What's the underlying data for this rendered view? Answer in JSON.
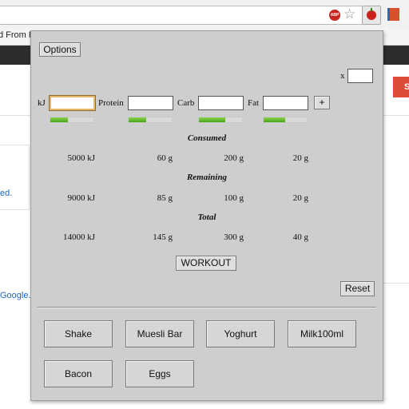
{
  "browser": {
    "bookmark_text": "d From Fi",
    "abp_label": "ABP",
    "red_button_label": "S",
    "link1": "ed.",
    "link2": "Google.c"
  },
  "popup": {
    "options_label": "Options",
    "x_label": "x",
    "labels": {
      "kj": "kJ",
      "protein": "Protein",
      "carb": "Carb",
      "fat": "Fat"
    },
    "plus_label": "+",
    "progress": {
      "kj": 0.4,
      "protein": 0.4,
      "carb": 0.62,
      "fat": 0.5
    },
    "sections": {
      "consumed": {
        "title": "Consumed",
        "values": [
          "5000 kJ",
          "60 g",
          "200 g",
          "20 g"
        ]
      },
      "remaining": {
        "title": "Remaining",
        "values": [
          "9000 kJ",
          "85 g",
          "100 g",
          "20 g"
        ]
      },
      "total": {
        "title": "Total",
        "values": [
          "14000 kJ",
          "145 g",
          "300 g",
          "40 g"
        ]
      }
    },
    "workout_label": "WORKOUT",
    "reset_label": "Reset",
    "foods": [
      "Shake",
      "Muesli Bar",
      "Yoghurt",
      "Milk100ml",
      "Bacon",
      "Eggs"
    ]
  }
}
